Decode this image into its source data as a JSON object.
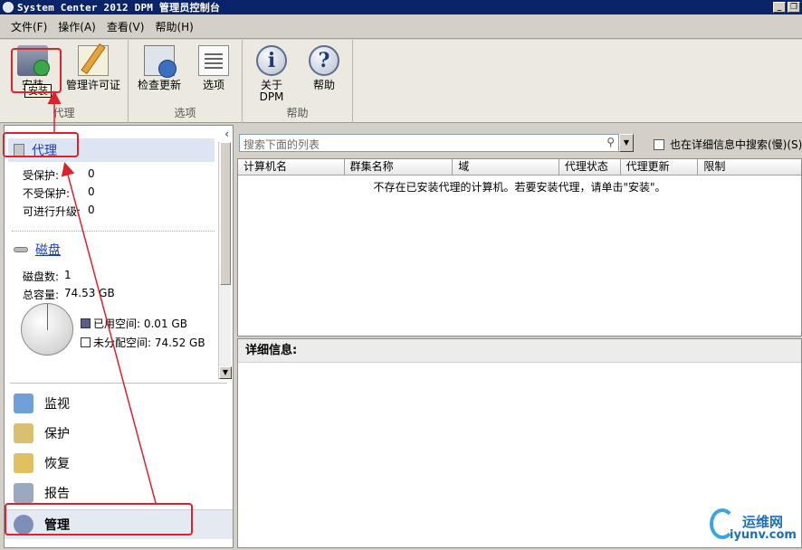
{
  "window": {
    "title": "System Center 2012 DPM 管理员控制台",
    "minimize": "_",
    "restore": "❐"
  },
  "menu": [
    "文件(F)",
    "操作(A)",
    "查看(V)",
    "帮助(H)"
  ],
  "ribbon": {
    "groups": [
      {
        "label": "代理",
        "buttons": [
          {
            "label": "安装",
            "icon": "install-icon"
          },
          {
            "label": "管理许可证",
            "icon": "license-icon"
          }
        ]
      },
      {
        "label": "选项",
        "buttons": [
          {
            "label": "检查更新",
            "icon": "check-update-icon"
          },
          {
            "label": "选项",
            "icon": "options-icon"
          }
        ]
      },
      {
        "label": "帮助",
        "buttons": [
          {
            "label": "关于\nDPM",
            "icon": "about-icon"
          },
          {
            "label": "帮助",
            "icon": "help-icon"
          }
        ]
      }
    ],
    "tooltip": "安装"
  },
  "left": {
    "agents": {
      "title": "代理",
      "rows": [
        {
          "label": "受保护:",
          "value": "0"
        },
        {
          "label": "不受保护:",
          "value": "0"
        },
        {
          "label": "可进行升级:",
          "value": "0"
        }
      ]
    },
    "disks": {
      "title": "磁盘",
      "count_label": "磁盘数:",
      "count": "1",
      "total_label": "总容量:",
      "total": "74.53 GB",
      "legend": [
        {
          "label": "已用空间: 0.01 GB",
          "color": "#5a5e8c"
        },
        {
          "label": "未分配空间: 74.52 GB",
          "color": "#ffffff"
        }
      ]
    },
    "nav": [
      {
        "label": "监视",
        "icon": "monitor-icon"
      },
      {
        "label": "保护",
        "icon": "protect-icon"
      },
      {
        "label": "恢复",
        "icon": "recover-icon"
      },
      {
        "label": "报告",
        "icon": "report-icon"
      },
      {
        "label": "管理",
        "icon": "manage-icon",
        "active": true
      }
    ]
  },
  "right": {
    "search_placeholder": "搜索下面的列表",
    "detail_search_label": "也在详细信息中搜索(慢)(S)",
    "columns": [
      "计算机名",
      "群集名称",
      "域",
      "代理状态",
      "代理更新",
      "限制"
    ],
    "empty_message": "不存在已安装代理的计算机。若要安装代理，请单击\"安装\"。",
    "details_title": "详细信息:"
  },
  "watermark": {
    "line1": "运维网",
    "line2": "iyunv.com"
  },
  "colors": {
    "annotation": "#e0202a",
    "title_bar": "#0a246a",
    "link": "#1a3bcb"
  }
}
